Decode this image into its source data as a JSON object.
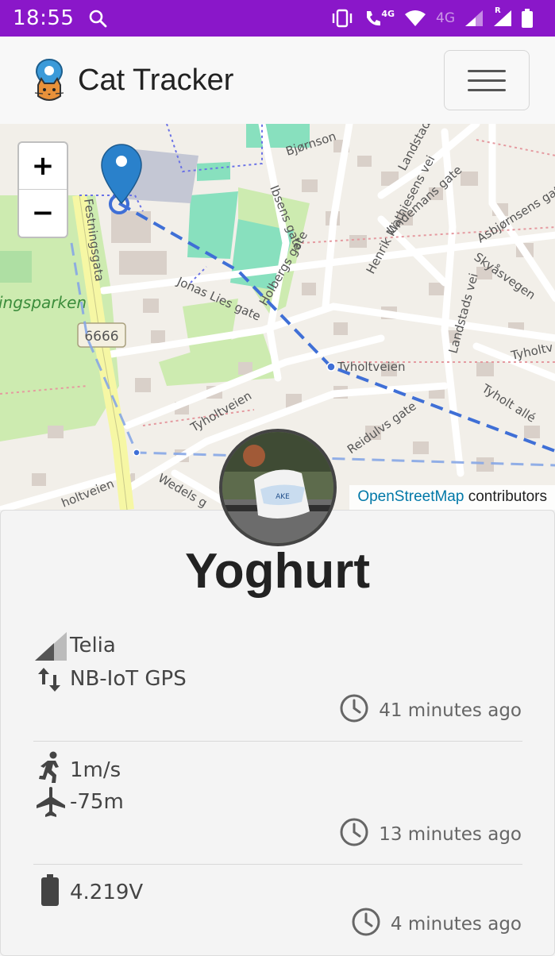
{
  "status_bar": {
    "time": "18:55",
    "network_a": "4G",
    "network_b": "4G",
    "roaming": "R",
    "color": "#8a17c9"
  },
  "header": {
    "title": "Cat Tracker",
    "logo_icon": "cat-pin-logo",
    "menu_icon": "hamburger-icon"
  },
  "map": {
    "zoom_in": "+",
    "zoom_out": "−",
    "attribution_link": "OpenStreetMap",
    "attribution_suffix": " contributors",
    "labels": {
      "park": "ingsparken",
      "road_number": "6666",
      "festningsgata": "Festningsgata",
      "jonas_lies": "Jonas Lies gate",
      "holbergs": "Holbergs gate",
      "ibsens": "Ibsens gate",
      "bjornson": "Bjørnson",
      "henrik_mathiesens": "Henrik Mathiesens vei",
      "lindemans": "Lindemans gate",
      "landstads": "Landstads vei",
      "asbjornsens": "Asbjørnsens gate",
      "skyasvegen": "Skyåsvegen",
      "tyholtveien_1": "Tyholtveien",
      "tyholtveien_2": "Tyholtveien",
      "tyholtveien_3": "Tyholtv",
      "tyholt_alle": "Tyholt allé",
      "reidulvs": "Reidulvs gate",
      "wedels": "Wedels g",
      "holtveien": "holtveien"
    }
  },
  "cat": {
    "name": "Yoghurt"
  },
  "sections": [
    {
      "lines": [
        {
          "icon": "signal-strength-icon",
          "text": "Telia"
        },
        {
          "icon": "data-transfer-icon",
          "text": "NB-IoT GPS"
        }
      ],
      "time": "41 minutes ago"
    },
    {
      "lines": [
        {
          "icon": "running-person-icon",
          "text": "1m/s"
        },
        {
          "icon": "airplane-icon",
          "text": "-75m"
        }
      ],
      "time": "13 minutes ago"
    },
    {
      "lines": [
        {
          "icon": "battery-icon",
          "text": "4.219V"
        }
      ],
      "time": "4 minutes ago"
    }
  ]
}
